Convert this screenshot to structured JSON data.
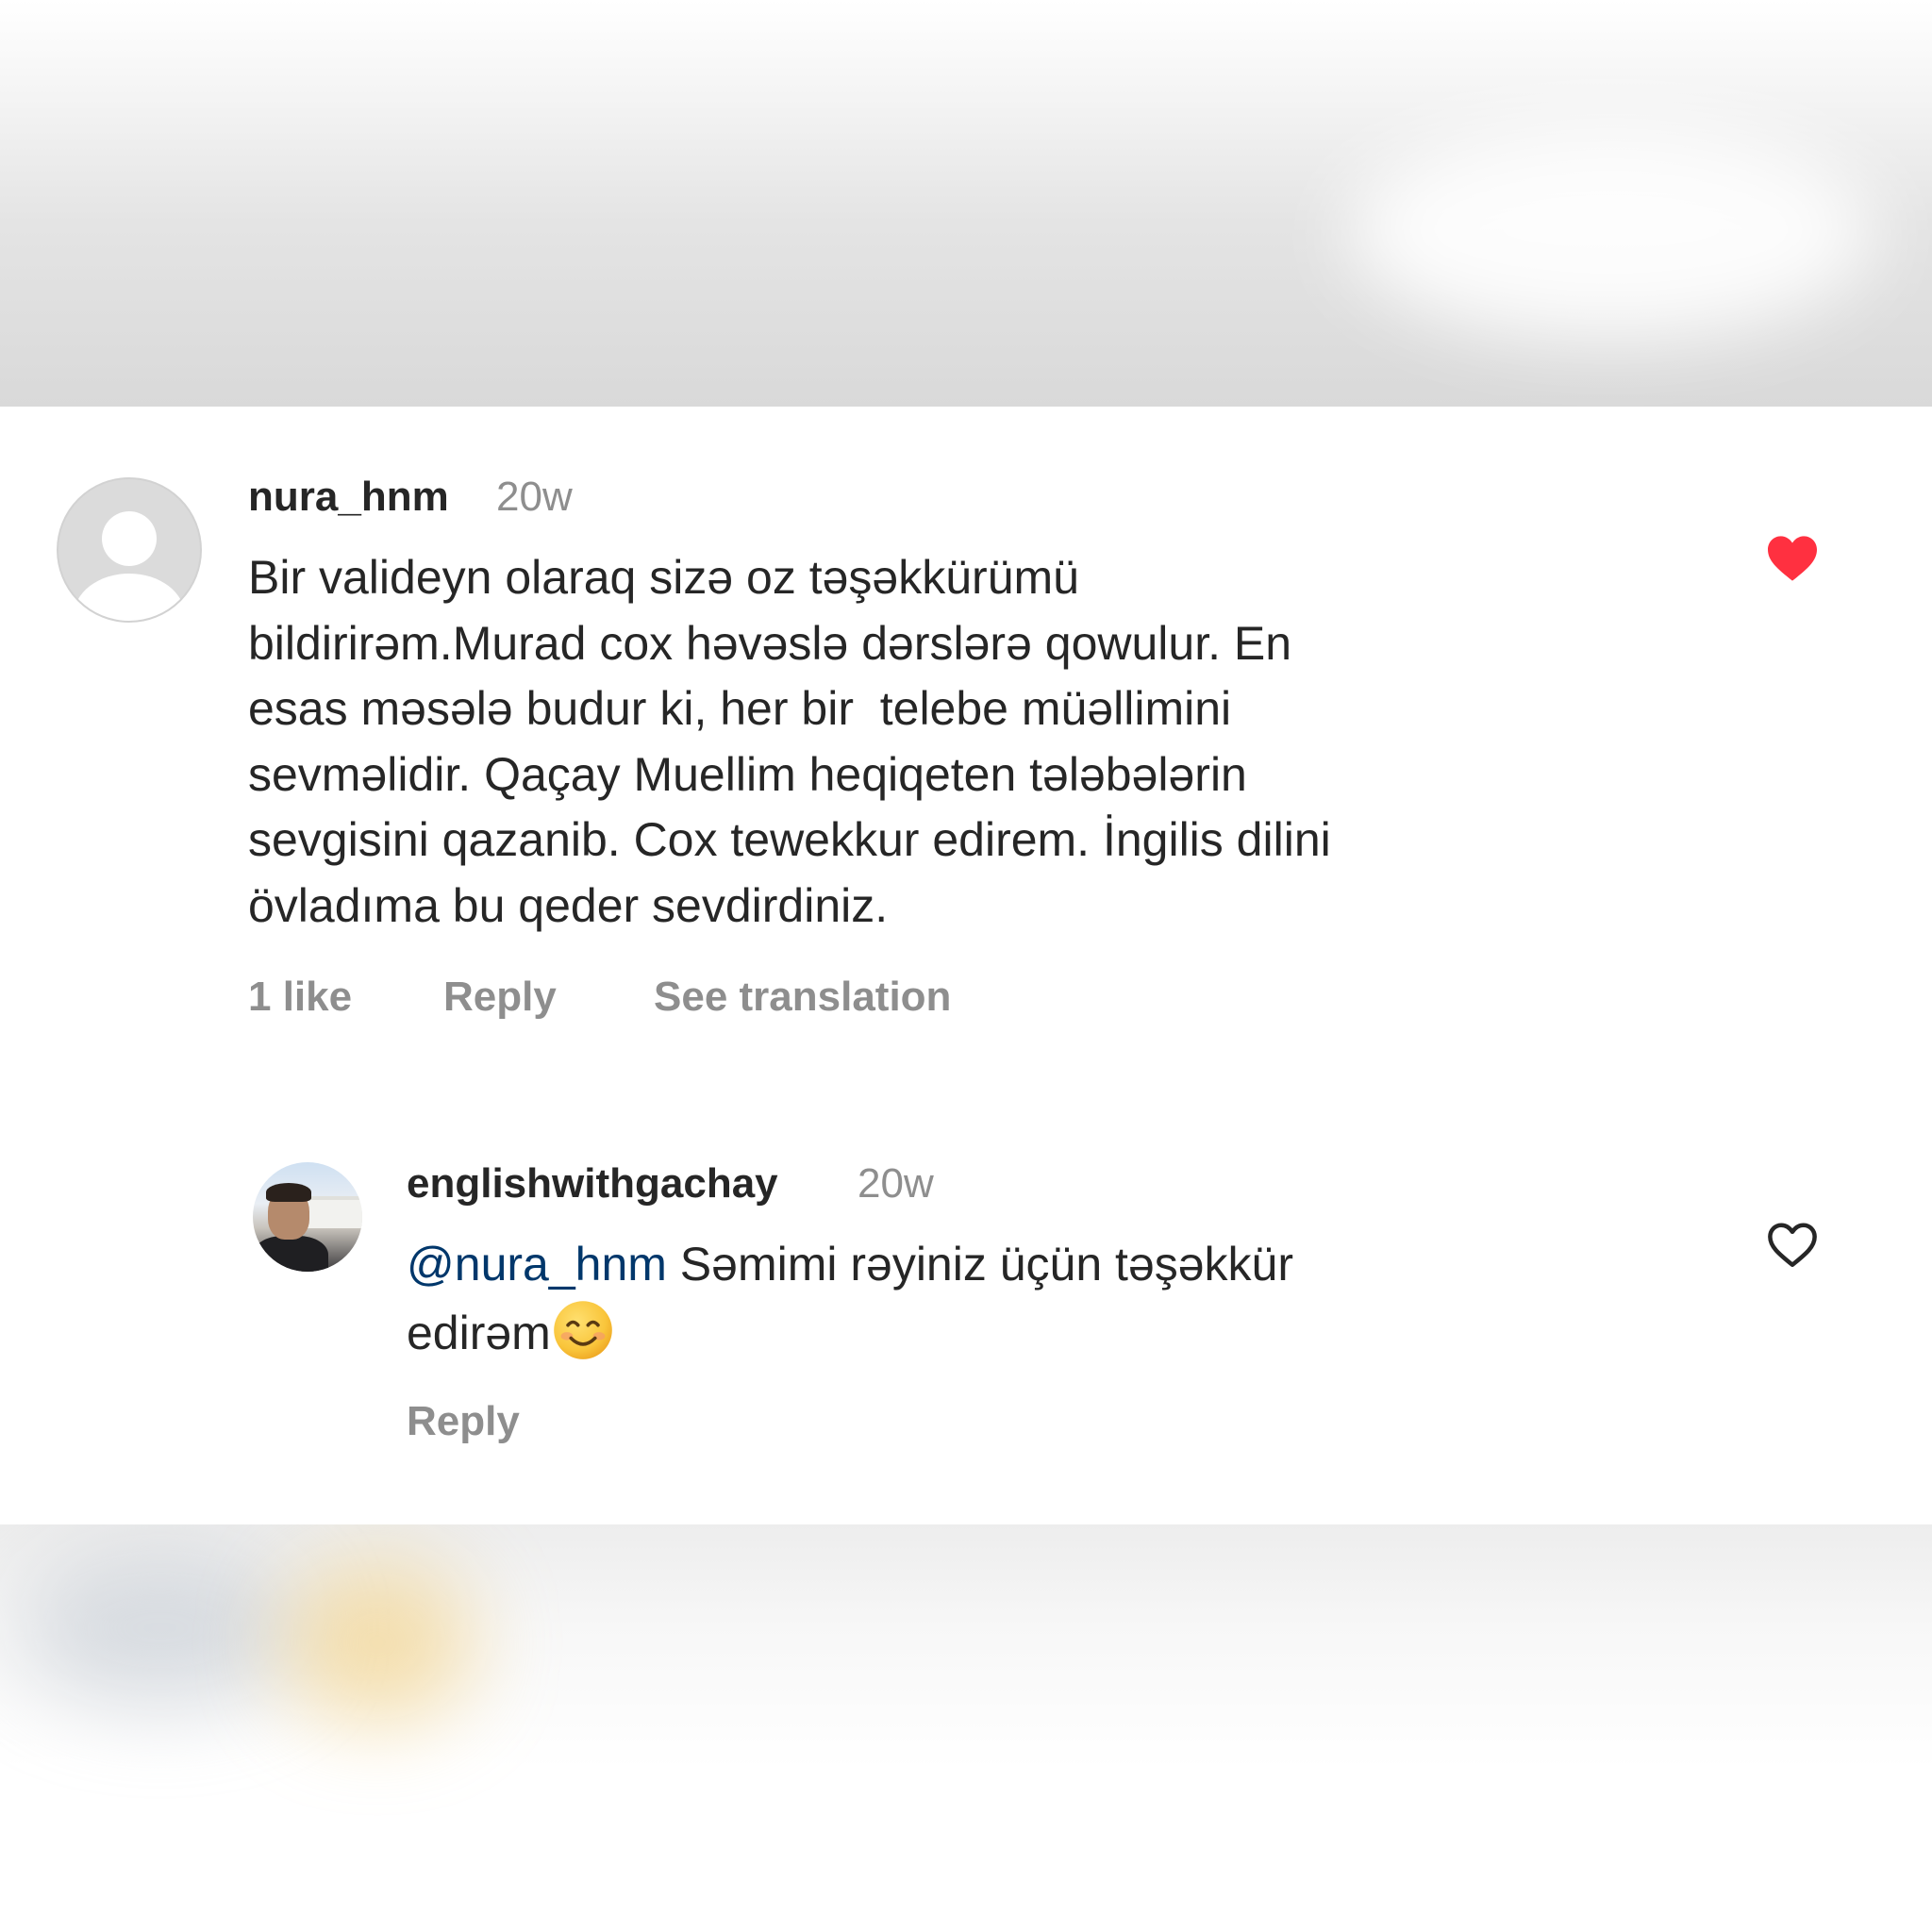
{
  "comments": [
    {
      "username": "nura_hnm",
      "time": "20w",
      "lines": [
        "Bir valideyn olaraq sizə oz təşəkkürümü",
        "bildirirəm.Murad cox həvəslə dərslərə qowulur. En",
        "esas məsələ budur ki, her bir  telebe müəllimini",
        "sevməlidir. Qaçay Muellim heqiqeten tələbələrin",
        "sevgisini qazanib. Cox tewekkur edirem. İngilis dilini",
        "övladıma bu qeder sevdirdiniz."
      ],
      "likes": "1 like",
      "reply": "Reply",
      "see_translation": "See translation",
      "liked": true,
      "heart_color": "#ff3040",
      "avatar_icon": "default-profile-icon"
    }
  ],
  "reply_comment": {
    "username": "englishwithgachay",
    "time": "20w",
    "mention": "@nura_hnm",
    "text_line1": " Səmimi rəyiniz üçün təşəkkür",
    "text_line2": "edirəm",
    "emoji": "smiling-face-emoji",
    "reply": "Reply",
    "liked": false,
    "heart_color": "#262626",
    "avatar_icon": "profile-photo"
  },
  "colors": {
    "text_primary": "#262626",
    "text_secondary": "#8e8e8e",
    "mention": "#00376b",
    "like_red": "#ff3040"
  }
}
